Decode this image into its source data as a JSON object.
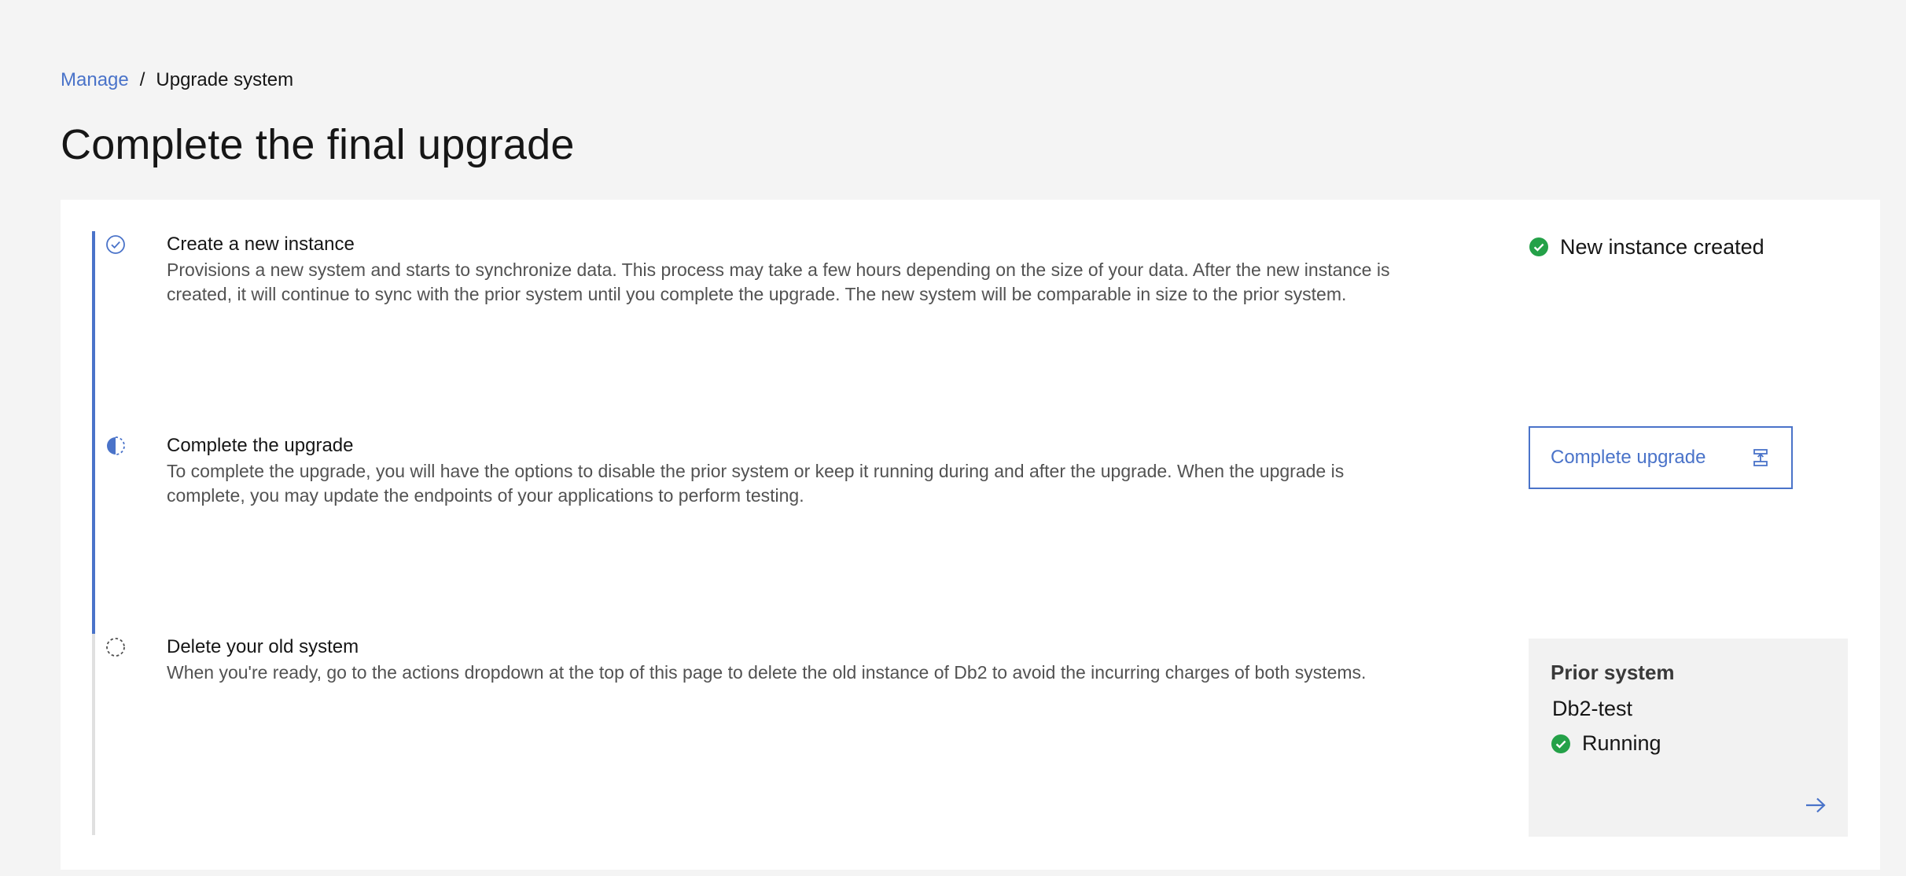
{
  "breadcrumb": {
    "link": "Manage",
    "separator": "/",
    "current": "Upgrade system"
  },
  "page": {
    "title": "Complete the final upgrade"
  },
  "progress": {
    "accent_color": "#4a73c9",
    "track_color": "#e0e0e0",
    "steps": [
      {
        "title": "Create a new instance",
        "description": "Provisions a new system and starts to synchronize data. This process may take a few hours depending on the size of your data. After the new instance is created, it will continue to sync with the prior system until you complete the upgrade. The new system will be comparable in size to the prior system.",
        "state": "complete",
        "icon": "checkmark-outline-icon"
      },
      {
        "title": "Complete the upgrade",
        "description": "To complete the upgrade, you will have the options to disable the prior system or keep it running during and after the upgrade. When the upgrade is complete, you may update the endpoints of your applications to perform testing.",
        "state": "current",
        "icon": "half-circle-icon"
      },
      {
        "title": "Delete your old system",
        "description": "When you're ready, go to the actions dropdown at the top of this page to delete the old instance of Db2 to avoid the incurring charges of both systems.",
        "state": "incomplete",
        "icon": "dashed-circle-icon"
      }
    ]
  },
  "status": {
    "created_label": "New instance created",
    "success_color": "#24a148"
  },
  "actions": {
    "complete_upgrade_label": "Complete upgrade",
    "complete_upgrade_icon": "upgrade-icon"
  },
  "prior_system": {
    "label": "Prior system",
    "name": "Db2-test",
    "status": "Running",
    "link_icon": "arrow-right-icon"
  }
}
